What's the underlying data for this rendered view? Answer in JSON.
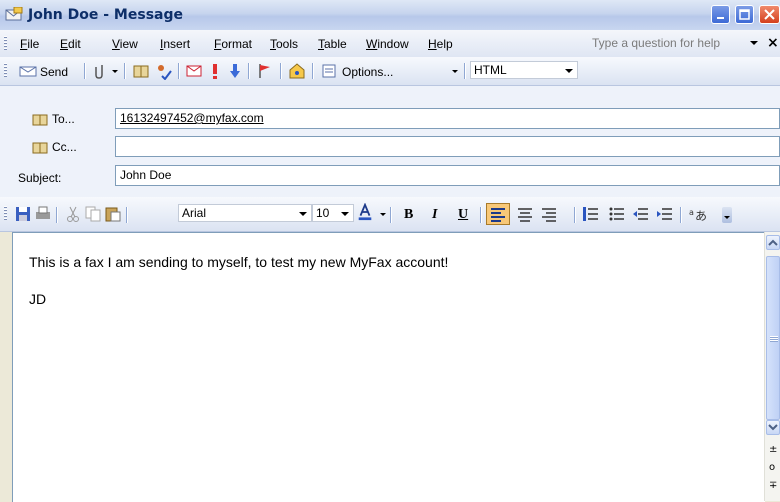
{
  "window": {
    "title": "John Doe - Message",
    "buttons": {
      "minimize": "minimize",
      "maximize": "maximize",
      "close": "close"
    }
  },
  "menubar": {
    "items": [
      "File",
      "Edit",
      "View",
      "Insert",
      "Format",
      "Tools",
      "Table",
      "Window",
      "Help"
    ],
    "help_placeholder": "Type a question for help"
  },
  "toolbar_standard": {
    "send_label": "Send",
    "options_label": "Options...",
    "format_value": "HTML"
  },
  "fields": {
    "to_label": "To...",
    "to_value": "16132497452@myfax.com",
    "cc_label": "Cc...",
    "cc_value": "",
    "subject_label": "Subject:",
    "subject_value": "John Doe"
  },
  "toolbar_format": {
    "font_value": "Arial",
    "size_value": "10"
  },
  "body": {
    "lines": [
      "This is a fax I am sending to myself, to test my new MyFax account!",
      "JD"
    ]
  },
  "colors": {
    "title_text": "#0d2e68",
    "titlebar_bg": "#c6d4ee",
    "close_button": "#d4401e",
    "highlight_align": "#f8c878"
  }
}
